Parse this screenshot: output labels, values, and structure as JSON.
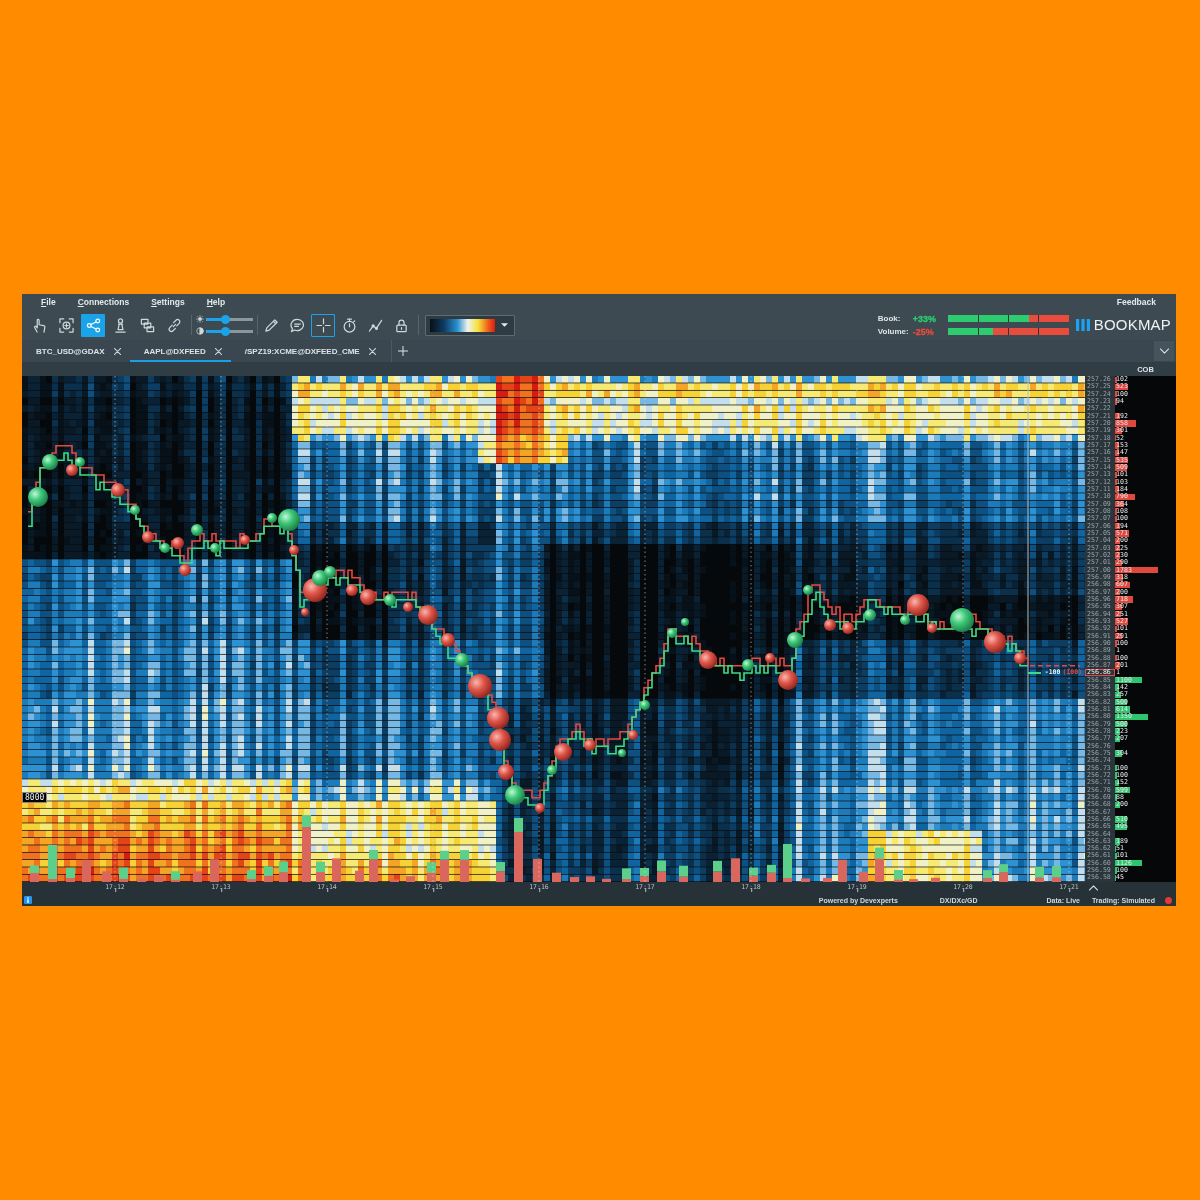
{
  "menu_bar": {
    "items": [
      "File",
      "Connections",
      "Settings",
      "Help"
    ],
    "feedback": "Feedback"
  },
  "toolbar": {
    "tools_left": [
      {
        "selected": false,
        "on": false
      },
      {
        "selected": false,
        "on": false
      },
      {
        "selected": true,
        "on": false
      },
      {
        "selected": false,
        "on": false
      },
      {
        "selected": false,
        "on": false
      },
      {
        "selected": false,
        "on": false
      }
    ],
    "sliders": [
      {
        "level": 0.4
      },
      {
        "level": 0.4
      }
    ],
    "tools_right": [
      {
        "selected": false,
        "on": false
      },
      {
        "selected": false,
        "on": false
      },
      {
        "selected": false,
        "on": true
      },
      {
        "selected": false,
        "on": false
      },
      {
        "selected": false,
        "on": false
      },
      {
        "selected": false,
        "on": false
      }
    ],
    "market_stats": [
      {
        "label": "Book:",
        "value": "+33%",
        "color": "#2ecc71",
        "level": 0.67
      },
      {
        "label": "Volume:",
        "value": "-25%",
        "color": "#e74c3c",
        "level": 0.37
      }
    ],
    "logo": "BOOKMAP"
  },
  "tabs": [
    {
      "label": "BTC_USD@GDAX",
      "selected": false
    },
    {
      "label": "AAPL@DXFEED",
      "selected": true
    },
    {
      "label": "/SPZ19:XCME@DXFEED_CME",
      "selected": false
    }
  ],
  "order_book": {
    "header": "COB",
    "rows": [
      {
        "price": "257.26",
        "size": "102",
        "kind": "ask",
        "level": 0.04
      },
      {
        "price": "257.25",
        "size": "523",
        "kind": "ask",
        "level": 0.21
      },
      {
        "price": "257.24",
        "size": "100",
        "kind": "ask",
        "level": 0.04
      },
      {
        "price": "257.23",
        "size": "94",
        "kind": "ask",
        "level": 0.04
      },
      {
        "price": "257.22",
        "kind": "ask"
      },
      {
        "price": "257.21",
        "size": "192",
        "kind": "ask",
        "level": 0.08
      },
      {
        "price": "257.20",
        "size": "858",
        "kind": "ask",
        "level": 0.34
      },
      {
        "price": "257.19",
        "size": "301",
        "kind": "ask",
        "level": 0.12
      },
      {
        "price": "257.18",
        "size": "52",
        "kind": "ask",
        "level": 0.02
      },
      {
        "price": "257.17",
        "size": "153",
        "kind": "ask",
        "level": 0.06
      },
      {
        "price": "257.16",
        "size": "147",
        "kind": "ask",
        "level": 0.06
      },
      {
        "price": "257.15",
        "size": "535",
        "kind": "ask",
        "level": 0.21
      },
      {
        "price": "257.14",
        "size": "509",
        "kind": "ask",
        "level": 0.2
      },
      {
        "price": "257.13",
        "size": "101",
        "kind": "ask",
        "level": 0.04
      },
      {
        "price": "257.12",
        "size": "103",
        "kind": "ask",
        "level": 0.04
      },
      {
        "price": "257.11",
        "size": "184",
        "kind": "ask",
        "level": 0.07
      },
      {
        "price": "257.10",
        "size": "790",
        "kind": "ask",
        "level": 0.32
      },
      {
        "price": "257.09",
        "size": "364",
        "kind": "ask",
        "level": 0.15
      },
      {
        "price": "257.08",
        "size": "108",
        "kind": "ask",
        "level": 0.04
      },
      {
        "price": "257.07",
        "size": "100",
        "kind": "ask",
        "level": 0.04
      },
      {
        "price": "257.06",
        "size": "194",
        "kind": "ask",
        "level": 0.08
      },
      {
        "price": "257.05",
        "size": "571",
        "kind": "ask",
        "level": 0.23
      },
      {
        "price": "257.04",
        "size": "200",
        "kind": "ask",
        "level": 0.08
      },
      {
        "price": "257.03",
        "size": "225",
        "kind": "ask",
        "level": 0.09
      },
      {
        "price": "257.02",
        "size": "230",
        "kind": "ask",
        "level": 0.09
      },
      {
        "price": "257.01",
        "size": "290",
        "kind": "ask",
        "level": 0.12
      },
      {
        "price": "257.00",
        "size": "1783",
        "kind": "ask",
        "level": 0.71
      },
      {
        "price": "256.99",
        "size": "318",
        "kind": "ask",
        "level": 0.13
      },
      {
        "price": "256.98",
        "size": "607",
        "kind": "ask",
        "level": 0.24
      },
      {
        "price": "256.97",
        "size": "200",
        "kind": "ask",
        "level": 0.08
      },
      {
        "price": "256.96",
        "size": "718",
        "kind": "ask",
        "level": 0.29
      },
      {
        "price": "256.95",
        "size": "307",
        "kind": "ask",
        "level": 0.12
      },
      {
        "price": "256.94",
        "size": "251",
        "kind": "ask",
        "level": 0.1
      },
      {
        "price": "256.93",
        "size": "527",
        "kind": "ask",
        "level": 0.21
      },
      {
        "price": "256.92",
        "size": "101",
        "kind": "ask",
        "level": 0.04
      },
      {
        "price": "256.91",
        "size": "291",
        "kind": "ask",
        "level": 0.12
      },
      {
        "price": "256.90",
        "size": "100",
        "kind": "ask",
        "level": 0.04
      },
      {
        "price": "256.89",
        "size": "1",
        "kind": "ask"
      },
      {
        "price": "256.88",
        "size": "100",
        "kind": "ask",
        "level": 0.04
      },
      {
        "price": "256.87",
        "size": "201",
        "kind": "ask",
        "level": 0.08
      },
      {
        "price": "256.86",
        "size": "1",
        "kind": "last"
      },
      {
        "price": "256.85",
        "size": "1100",
        "kind": "bid",
        "level": 0.44
      },
      {
        "price": "256.84",
        "size": "142",
        "kind": "bid",
        "level": 0.06
      },
      {
        "price": "256.83",
        "size": "257",
        "kind": "bid",
        "level": 0.1
      },
      {
        "price": "256.82",
        "size": "500",
        "kind": "bid",
        "level": 0.2
      },
      {
        "price": "256.81",
        "size": "614",
        "kind": "bid",
        "level": 0.25
      },
      {
        "price": "256.80",
        "size": "1350",
        "kind": "bid",
        "level": 0.54
      },
      {
        "price": "256.79",
        "size": "500",
        "kind": "bid",
        "level": 0.2
      },
      {
        "price": "256.78",
        "size": "223",
        "kind": "bid",
        "level": 0.09
      },
      {
        "price": "256.77",
        "size": "207",
        "kind": "bid",
        "level": 0.08
      },
      {
        "price": "256.76",
        "kind": "bid"
      },
      {
        "price": "256.75",
        "size": "304",
        "kind": "bid",
        "level": 0.12
      },
      {
        "price": "256.74",
        "kind": "bid"
      },
      {
        "price": "256.73",
        "size": "100",
        "kind": "bid",
        "level": 0.04
      },
      {
        "price": "256.72",
        "size": "100",
        "kind": "bid",
        "level": 0.04
      },
      {
        "price": "256.71",
        "size": "152",
        "kind": "bid",
        "level": 0.06
      },
      {
        "price": "256.70",
        "size": "599",
        "kind": "bid",
        "level": 0.24
      },
      {
        "price": "256.69",
        "size": "88",
        "kind": "bid",
        "level": 0.04
      },
      {
        "price": "256.68",
        "size": "200",
        "kind": "bid",
        "level": 0.08
      },
      {
        "price": "256.67",
        "kind": "bid"
      },
      {
        "price": "256.66",
        "size": "510",
        "kind": "bid",
        "level": 0.2
      },
      {
        "price": "256.65",
        "size": "495",
        "kind": "bid",
        "level": 0.2
      },
      {
        "price": "256.64",
        "kind": "bid"
      },
      {
        "price": "256.63",
        "size": "189",
        "kind": "bid",
        "level": 0.08
      },
      {
        "price": "256.62",
        "size": "51",
        "kind": "bid",
        "level": 0.02
      },
      {
        "price": "256.61",
        "size": "101",
        "kind": "bid",
        "level": 0.04
      },
      {
        "price": "256.60",
        "size": "1126",
        "kind": "bid",
        "level": 0.45
      },
      {
        "price": "256.59",
        "size": "100",
        "kind": "bid",
        "level": 0.04
      },
      {
        "price": "256.58",
        "size": "45",
        "kind": "bid",
        "level": 0.02
      }
    ]
  },
  "chart": {
    "volume_scale_label": "8000",
    "position_marker": {
      "size": "-100",
      "quantity": "(100)"
    },
    "time_axis": [
      "17:12",
      "17:13",
      "17:14",
      "17:15",
      "17:16",
      "17:17",
      "17:18",
      "17:19",
      "17:20",
      "17:21"
    ]
  },
  "status_bar": {
    "powered_by": "Powered by Devexperts",
    "feed": "DX/DXc/GD",
    "data": "Data: Live",
    "trading": "Trading: Simulated"
  }
}
